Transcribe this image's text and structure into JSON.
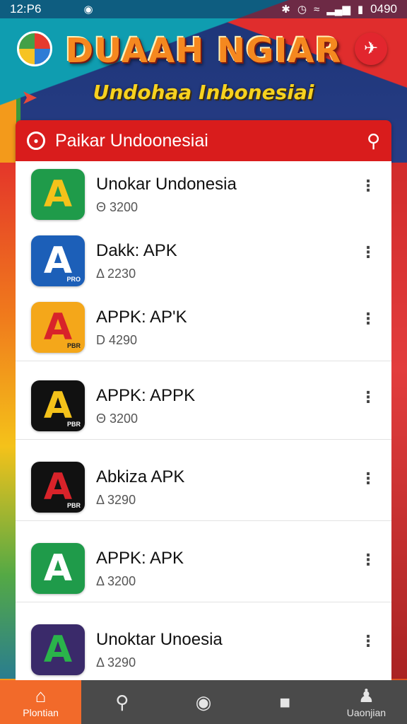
{
  "status_bar": {
    "time": "12:P6",
    "battery_text": "0490",
    "icons": [
      "notification-icon",
      "bluetooth-icon",
      "alarm-icon",
      "wifi-icon",
      "signal-icon",
      "battery-icon"
    ]
  },
  "header": {
    "title": "DUAAH NGIAR",
    "subtitle": "Undohaa Inbonesiai"
  },
  "search_bar": {
    "title": "Paikar Undoonesiai",
    "lead_icon": "search-icon",
    "action_icon": "search-icon"
  },
  "apps": [
    {
      "name": "Unokar Undonesia",
      "meta": "Θ 3200",
      "icon_color": "#1f9b4a",
      "glyph_color": "#f4c21a",
      "glyph": "A",
      "mini": ""
    },
    {
      "name": "Dakk: APK",
      "meta": "Δ 2230",
      "icon_color": "#1c5fb8",
      "glyph_color": "#ffffff",
      "glyph": "A",
      "mini": "PRO"
    },
    {
      "name": "APPK: AP'K",
      "meta": "D 4290",
      "icon_color": "#f4a71a",
      "glyph_color": "#d8232a",
      "glyph": "A",
      "mini": "PBR"
    },
    {
      "name": "APPK: APPK",
      "meta": "Θ 3200",
      "icon_color": "#111111",
      "glyph_color": "#f4c21a",
      "glyph": "A",
      "mini": "PBR"
    },
    {
      "name": "Abkiza APK",
      "meta": "Δ 3290",
      "icon_color": "#111111",
      "glyph_color": "#d8232a",
      "glyph": "A",
      "mini": "PBR"
    },
    {
      "name": "APPK: APK",
      "meta": "Δ 3200",
      "icon_color": "#1f9b4a",
      "glyph_color": "#ffffff",
      "glyph": "A",
      "mini": ""
    },
    {
      "name": "Unoktar Unoesia",
      "meta": "Δ 3290",
      "icon_color": "#3a2a6a",
      "glyph_color": "#2ab44a",
      "glyph": "A",
      "mini": ""
    }
  ],
  "bottom_nav": [
    {
      "label": "Plontian",
      "icon": "home-icon",
      "active": true
    },
    {
      "label": "",
      "icon": "search-icon",
      "active": false
    },
    {
      "label": "",
      "icon": "circle-icon",
      "active": false
    },
    {
      "label": "",
      "icon": "square-icon",
      "active": false
    },
    {
      "label": "Uaonjian",
      "icon": "profile-icon",
      "active": false
    }
  ],
  "colors": {
    "search_bar": "#d91c1c",
    "nav_active": "#f26a2a",
    "nav_bg": "#4a4a4a"
  }
}
